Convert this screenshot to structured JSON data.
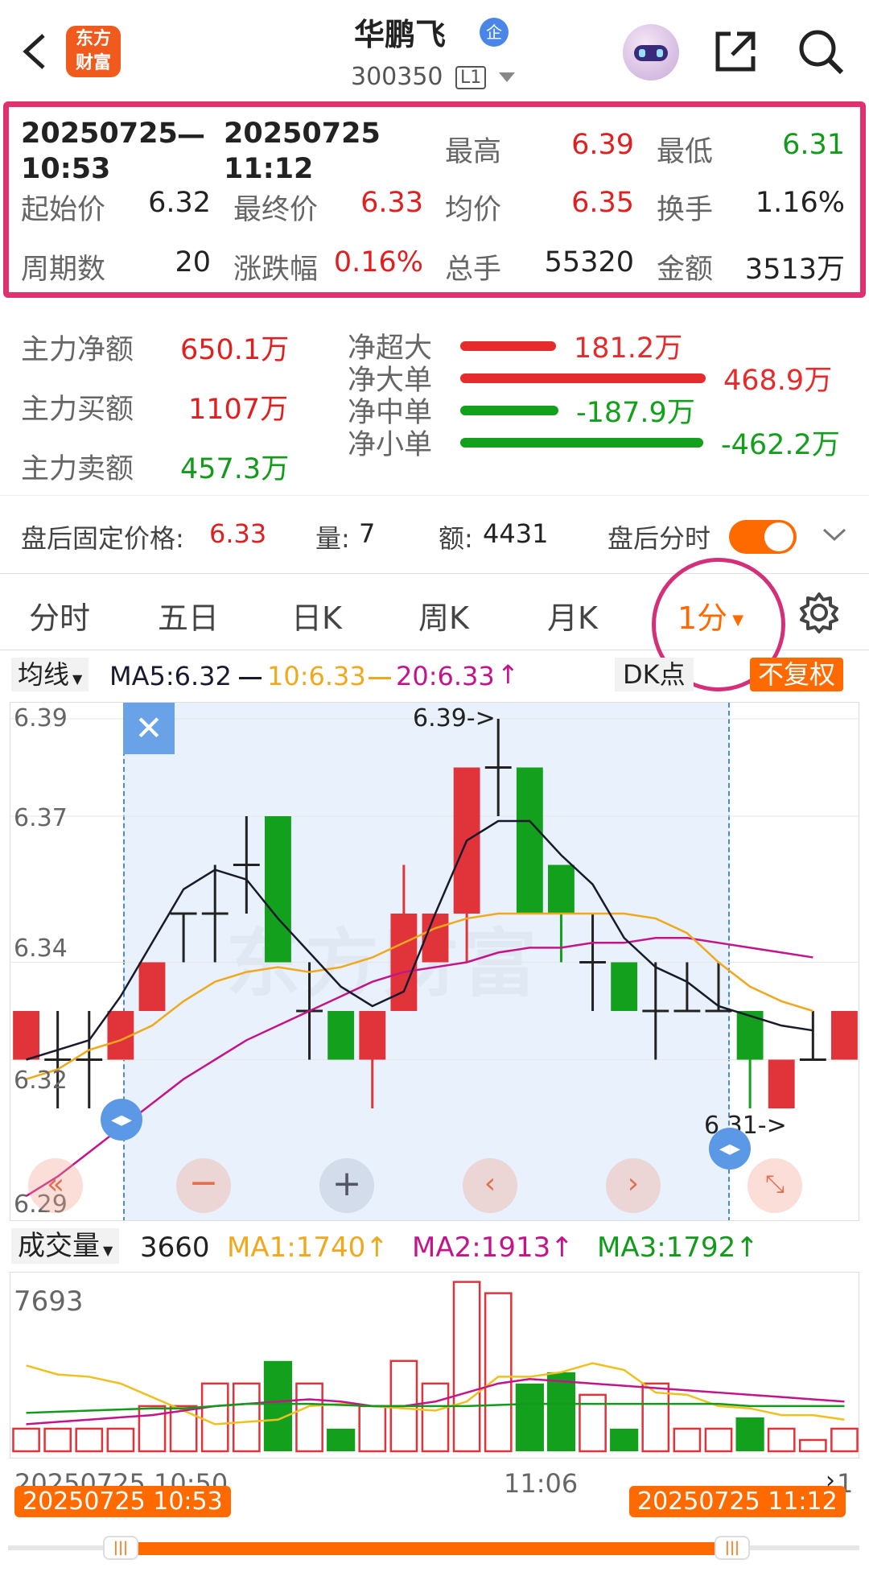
{
  "header": {
    "title": "华鹏飞",
    "code": "300350",
    "level": "L1",
    "badge": "企",
    "logo_top": "东方",
    "logo_bottom": "财富"
  },
  "summary": {
    "start": "20250725\n10:53",
    "dash": "—",
    "end": "20250725\n11:12",
    "high_label": "最高",
    "high": "6.39",
    "low_label": "最低",
    "low": "6.31",
    "open_label": "起始价",
    "open": "6.32",
    "close_label": "最终价",
    "close": "6.33",
    "avg_label": "均价",
    "avg": "6.35",
    "turnover_label": "换手",
    "turnover": "1.16%",
    "periods_label": "周期数",
    "periods": "20",
    "change_label": "涨跌幅",
    "change": "0.16%",
    "vol_label": "总手",
    "vol": "55320",
    "amount_label": "金额",
    "amount": "3513万"
  },
  "flow": {
    "net_label": "主力净额",
    "net": "650.1万",
    "buy_label": "主力买额",
    "buy": "1107万",
    "sell_label": "主力卖额",
    "sell": "457.3万",
    "bars": [
      {
        "label": "净超大",
        "value": "181.2万",
        "color": "#e52b2b",
        "frac": 0.39
      },
      {
        "label": "净大单",
        "value": "468.9万",
        "color": "#e52b2b",
        "frac": 1.0
      },
      {
        "label": "净中单",
        "value": "-187.9万",
        "color": "#13a01c",
        "frac": 0.4
      },
      {
        "label": "净小单",
        "value": "-462.2万",
        "color": "#13a01c",
        "frac": 0.99
      }
    ]
  },
  "after": {
    "price_label": "盘后固定价格:",
    "price": "6.33",
    "qty_label": "量:",
    "qty": "7",
    "amt_label": "额:",
    "amt": "4431",
    "toggle_label": "盘后分时"
  },
  "tabs": [
    "分时",
    "五日",
    "日K",
    "周K",
    "月K",
    "1分"
  ],
  "ma": {
    "selector": "均线",
    "ma5": "MA5:6.32",
    "ma10": "10:6.33",
    "ma20": "20:6.33",
    "dk": "DK点",
    "fq": "不复权"
  },
  "price_axis": [
    "6.39",
    "6.37",
    "6.34",
    "6.32",
    "6.29"
  ],
  "price_annotations": {
    "high": "6.39->",
    "low": "6.31->"
  },
  "vol": {
    "selector": "成交量",
    "value": "3660",
    "ma1": "MA1:1740",
    "ma2": "MA2:1913",
    "ma3": "MA3:1792",
    "axis_top": "7693"
  },
  "time_axis": {
    "left": "20250725 10:50",
    "mid": "11:06",
    "right": "1"
  },
  "range": {
    "start": "20250725 10:53",
    "end": "20250725 11:12"
  },
  "colors": {
    "up": "#e0343a",
    "down": "#13a01c",
    "accent": "#ff6a00",
    "ma5": "#1a1a2e",
    "ma10": "#f0a81c",
    "ma20": "#c4148c",
    "frame": "#e0306e"
  },
  "chart_data": {
    "type": "candlestick",
    "ylim": [
      6.29,
      6.39
    ],
    "candles": [
      {
        "o": 6.32,
        "c": 6.33,
        "h": 6.32,
        "l": 6.32,
        "v": 1
      },
      {
        "o": 6.32,
        "c": 6.32,
        "h": 6.33,
        "l": 6.31,
        "v": 1
      },
      {
        "o": 6.32,
        "c": 6.32,
        "h": 6.33,
        "l": 6.31,
        "v": 1
      },
      {
        "o": 6.32,
        "c": 6.33,
        "h": 6.33,
        "l": 6.32,
        "v": 1
      },
      {
        "o": 6.33,
        "c": 6.34,
        "h": 6.34,
        "l": 6.33,
        "v": 2
      },
      {
        "o": 6.35,
        "c": 6.35,
        "h": 6.35,
        "l": 6.34,
        "v": 2
      },
      {
        "o": 6.35,
        "c": 6.35,
        "h": 6.36,
        "l": 6.34,
        "v": 3
      },
      {
        "o": 6.36,
        "c": 6.36,
        "h": 6.37,
        "l": 6.35,
        "v": 3
      },
      {
        "o": 6.37,
        "c": 6.34,
        "h": 6.37,
        "l": 6.34,
        "v": 4
      },
      {
        "o": 6.33,
        "c": 6.33,
        "h": 6.34,
        "l": 6.32,
        "v": 3
      },
      {
        "o": 6.33,
        "c": 6.32,
        "h": 6.33,
        "l": 6.32,
        "v": 1
      },
      {
        "o": 6.32,
        "c": 6.33,
        "h": 6.33,
        "l": 6.31,
        "v": 2
      },
      {
        "o": 6.33,
        "c": 6.35,
        "h": 6.36,
        "l": 6.33,
        "v": 4
      },
      {
        "o": 6.34,
        "c": 6.35,
        "h": 6.35,
        "l": 6.34,
        "v": 3
      },
      {
        "o": 6.35,
        "c": 6.38,
        "h": 6.38,
        "l": 6.34,
        "v": 7.5
      },
      {
        "o": 6.38,
        "c": 6.38,
        "h": 6.39,
        "l": 6.37,
        "v": 7
      },
      {
        "o": 6.38,
        "c": 6.35,
        "h": 6.38,
        "l": 6.35,
        "v": 3
      },
      {
        "o": 6.36,
        "c": 6.35,
        "h": 6.36,
        "l": 6.34,
        "v": 3.5
      },
      {
        "o": 6.34,
        "c": 6.34,
        "h": 6.35,
        "l": 6.33,
        "v": 2.5
      },
      {
        "o": 6.34,
        "c": 6.33,
        "h": 6.34,
        "l": 6.33,
        "v": 1
      },
      {
        "o": 6.33,
        "c": 6.33,
        "h": 6.34,
        "l": 6.32,
        "v": 3
      },
      {
        "o": 6.33,
        "c": 6.33,
        "h": 6.34,
        "l": 6.33,
        "v": 1
      },
      {
        "o": 6.33,
        "c": 6.33,
        "h": 6.34,
        "l": 6.33,
        "v": 1
      },
      {
        "o": 6.33,
        "c": 6.32,
        "h": 6.33,
        "l": 6.31,
        "v": 1.5
      },
      {
        "o": 6.31,
        "c": 6.32,
        "h": 6.32,
        "l": 6.31,
        "v": 1
      },
      {
        "o": 6.32,
        "c": 6.32,
        "h": 6.33,
        "l": 6.32,
        "v": 0.5
      },
      {
        "o": 6.32,
        "c": 6.33,
        "h": 6.33,
        "l": 6.32,
        "v": 1
      }
    ],
    "ma5": [
      6.32,
      6.322,
      6.324,
      6.333,
      6.344,
      6.355,
      6.359,
      6.357,
      6.349,
      6.342,
      6.335,
      6.331,
      6.334,
      6.35,
      6.365,
      6.369,
      6.369,
      6.362,
      6.356,
      6.345,
      6.339,
      6.336,
      6.331,
      6.329,
      6.327,
      6.326
    ],
    "ma10": [
      6.316,
      6.318,
      6.322,
      6.324,
      6.327,
      6.332,
      6.336,
      6.338,
      6.339,
      6.338,
      6.339,
      6.341,
      6.344,
      6.347,
      6.349,
      6.35,
      6.35,
      6.35,
      6.35,
      6.35,
      6.349,
      6.346,
      6.34,
      6.335,
      6.332,
      6.33
    ],
    "ma20": [
      6.292,
      6.296,
      6.301,
      6.306,
      6.311,
      6.316,
      6.32,
      6.324,
      6.327,
      6.33,
      6.333,
      6.336,
      6.338,
      6.339,
      6.34,
      6.342,
      6.343,
      6.343,
      6.344,
      6.344,
      6.345,
      6.345,
      6.344,
      6.343,
      6.342,
      6.341
    ],
    "vma1": [
      3.8,
      3.4,
      3.3,
      3.0,
      2.4,
      1.8,
      1.2,
      1.3,
      1.4,
      2.0,
      2.1,
      2.0,
      1.9,
      1.8,
      2.2,
      3.3,
      3.3,
      3.5,
      3.9,
      3.6,
      2.6,
      2.5,
      2.0,
      1.9,
      1.6,
      1.6,
      1.4
    ],
    "vma2": [
      1.2,
      1.3,
      1.4,
      1.5,
      1.6,
      1.8,
      2.0,
      2.1,
      2.2,
      2.3,
      2.2,
      2.0,
      2.0,
      2.2,
      2.6,
      3.0,
      3.2,
      3.1,
      3.0,
      2.9,
      2.8,
      2.7,
      2.6,
      2.5,
      2.4,
      2.3,
      2.2
    ],
    "vma3": [
      1.7,
      1.75,
      1.8,
      1.85,
      1.9,
      1.9,
      2.0,
      2.1,
      2.1,
      2.1,
      2.05,
      2.0,
      2.0,
      2.0,
      2.0,
      2.05,
      2.1,
      2.1,
      2.1,
      2.1,
      2.1,
      2.1,
      2.1,
      2.0,
      2.0,
      2.0,
      2.0
    ]
  }
}
